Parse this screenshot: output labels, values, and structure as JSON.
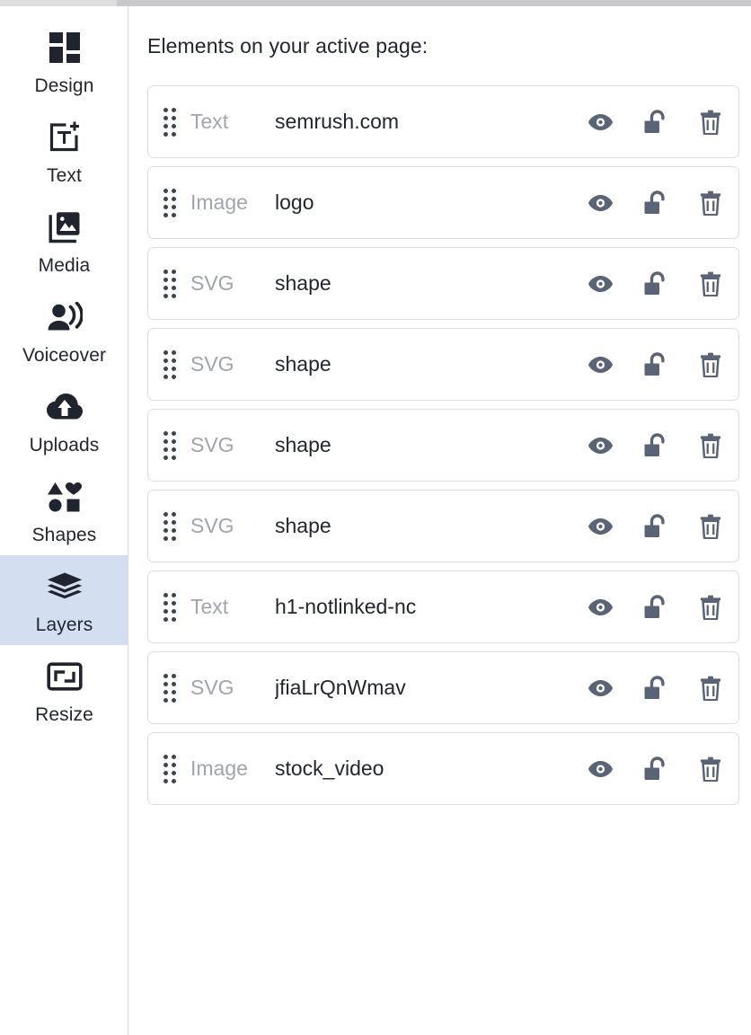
{
  "app": {
    "accent_active_bg": "#d3dff1",
    "icon_color": "#20242e",
    "row_action_color": "#5b6476",
    "muted_text_color": "#a0a4ad",
    "text_color": "#22262f",
    "border_color": "#dcdde1"
  },
  "sidebar": {
    "items": [
      {
        "label": "Design",
        "icon": "grid-blocks-icon",
        "active": false
      },
      {
        "label": "Text",
        "icon": "add-text-icon",
        "active": false
      },
      {
        "label": "Media",
        "icon": "image-stack-icon",
        "active": false
      },
      {
        "label": "Voiceover",
        "icon": "person-speaking-icon",
        "active": false
      },
      {
        "label": "Uploads",
        "icon": "cloud-upload-icon",
        "active": false
      },
      {
        "label": "Shapes",
        "icon": "shapes-icon",
        "active": false
      },
      {
        "label": "Layers",
        "icon": "layers-stack-icon",
        "active": true
      },
      {
        "label": "Resize",
        "icon": "resize-frame-icon",
        "active": false
      }
    ]
  },
  "main": {
    "title": "Elements on your active page:",
    "row_actions": [
      {
        "name": "toggle-visibility-button",
        "icon": "eye-icon"
      },
      {
        "name": "toggle-lock-button",
        "icon": "unlock-icon"
      },
      {
        "name": "delete-layer-button",
        "icon": "trash-icon"
      }
    ],
    "layers": [
      {
        "type": "Text",
        "name": "semrush.com"
      },
      {
        "type": "Image",
        "name": "logo"
      },
      {
        "type": "SVG",
        "name": "shape"
      },
      {
        "type": "SVG",
        "name": "shape"
      },
      {
        "type": "SVG",
        "name": "shape"
      },
      {
        "type": "SVG",
        "name": "shape"
      },
      {
        "type": "Text",
        "name": "h1-notlinked-nc"
      },
      {
        "type": "SVG",
        "name": "jfiaLrQnWmav"
      },
      {
        "type": "Image",
        "name": "stock_video"
      }
    ]
  }
}
